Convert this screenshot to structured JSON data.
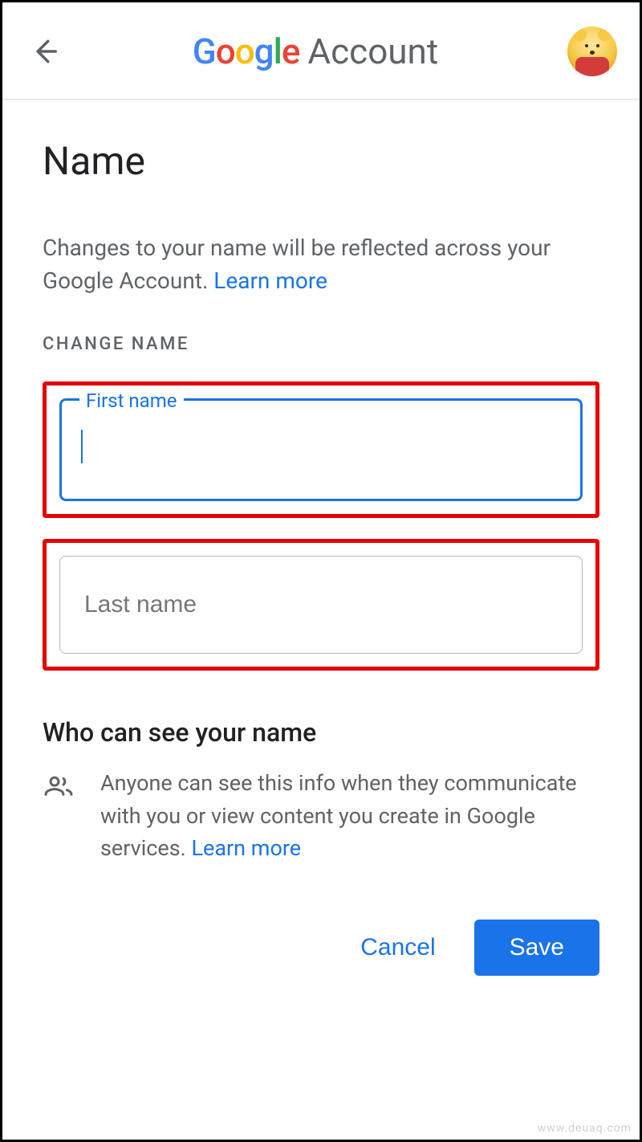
{
  "header": {
    "logo_text": "Google",
    "logo_suffix": "Account"
  },
  "page": {
    "title": "Name",
    "description_prefix": "Changes to your name will be reflected across your Google Account. ",
    "learn_more": "Learn more",
    "section_label": "CHANGE NAME"
  },
  "fields": {
    "first_name_label": "First name",
    "first_name_value": "",
    "last_name_placeholder": "Last name",
    "last_name_value": ""
  },
  "visibility": {
    "heading": "Who can see your name",
    "body_prefix": "Anyone can see this info when they com­municate with you or view content you cre­ate in Google services. ",
    "learn_more": "Learn more"
  },
  "actions": {
    "cancel": "Cancel",
    "save": "Save"
  },
  "watermark": "www.deuaq.com"
}
